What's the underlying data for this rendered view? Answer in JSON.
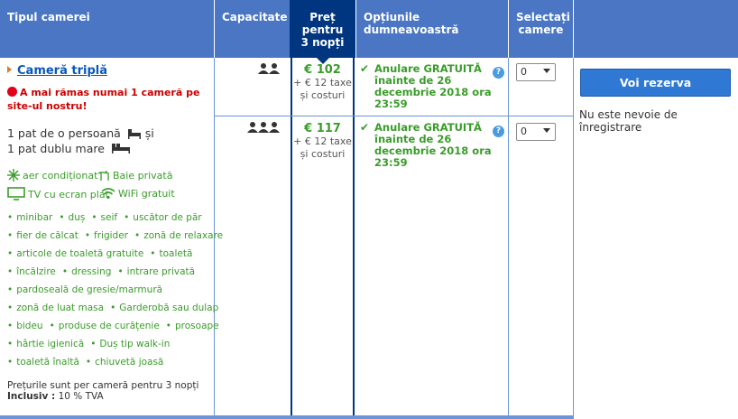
{
  "headers": {
    "room_type": "Tipul camerei",
    "capacity": "Capacitate",
    "price": "Preț pentru 3 nopți",
    "options": "Opțiunile dumneavoastră",
    "select": "Selectați camere"
  },
  "room": {
    "name": "Cameră triplă",
    "alert": "A mai rămas numai 1 cameră pe site-ul nostru!",
    "bed_line1": "1 pat de o persoană",
    "bed_conj": "și",
    "bed_line2": "1 pat dublu mare",
    "amenities": {
      "ac": "aer condiționat",
      "bath": "Baie privată",
      "tv": "TV cu ecran plat",
      "wifi": "WiFi gratuit"
    },
    "facilities": [
      "minibar",
      "duș",
      "seif",
      "uscător de păr",
      "fier de călcat",
      "frigider",
      "zonă de relaxare",
      "articole de toaletă gratuite",
      "toaletă",
      "încălzire",
      "dressing",
      "intrare privată",
      "pardoseală de gresie/marmură",
      "zonă de luat masa",
      "Garderobă sau dulap",
      "bideu",
      "produse de curățenie",
      "prosoape",
      "hârtie igienică",
      "Duș tip walk-in",
      "toaletă înaltă",
      "chiuvetă joasă"
    ],
    "note_line1": "Prețurile sunt per cameră pentru 3 nopți",
    "note_inclusive_label": "Inclusiv :",
    "note_inclusive_value": "10 % TVA"
  },
  "rates": [
    {
      "capacity": 2,
      "price": "€ 102",
      "tax": "+ € 12 taxe și costuri",
      "cancel": "Anulare GRATUITĂ înainte de 26 decembrie 2018 ora 23:59",
      "select_value": "0"
    },
    {
      "capacity": 3,
      "price": "€ 117",
      "tax": "+ € 12 taxe și costuri",
      "cancel": "Anulare GRATUITĂ înainte de 26 decembrie 2018 ora 23:59",
      "select_value": "0"
    }
  ],
  "reserve_label": "Voi rezerva",
  "reg_note": "Nu este nevoie de înregistrare",
  "help_glyph": "?",
  "colors": {
    "header": "#4a76c4",
    "header_selected": "#003580",
    "green": "#3a9c2a",
    "link": "#0a58b8",
    "alert": "#cc0000",
    "button": "#2f78d4"
  }
}
